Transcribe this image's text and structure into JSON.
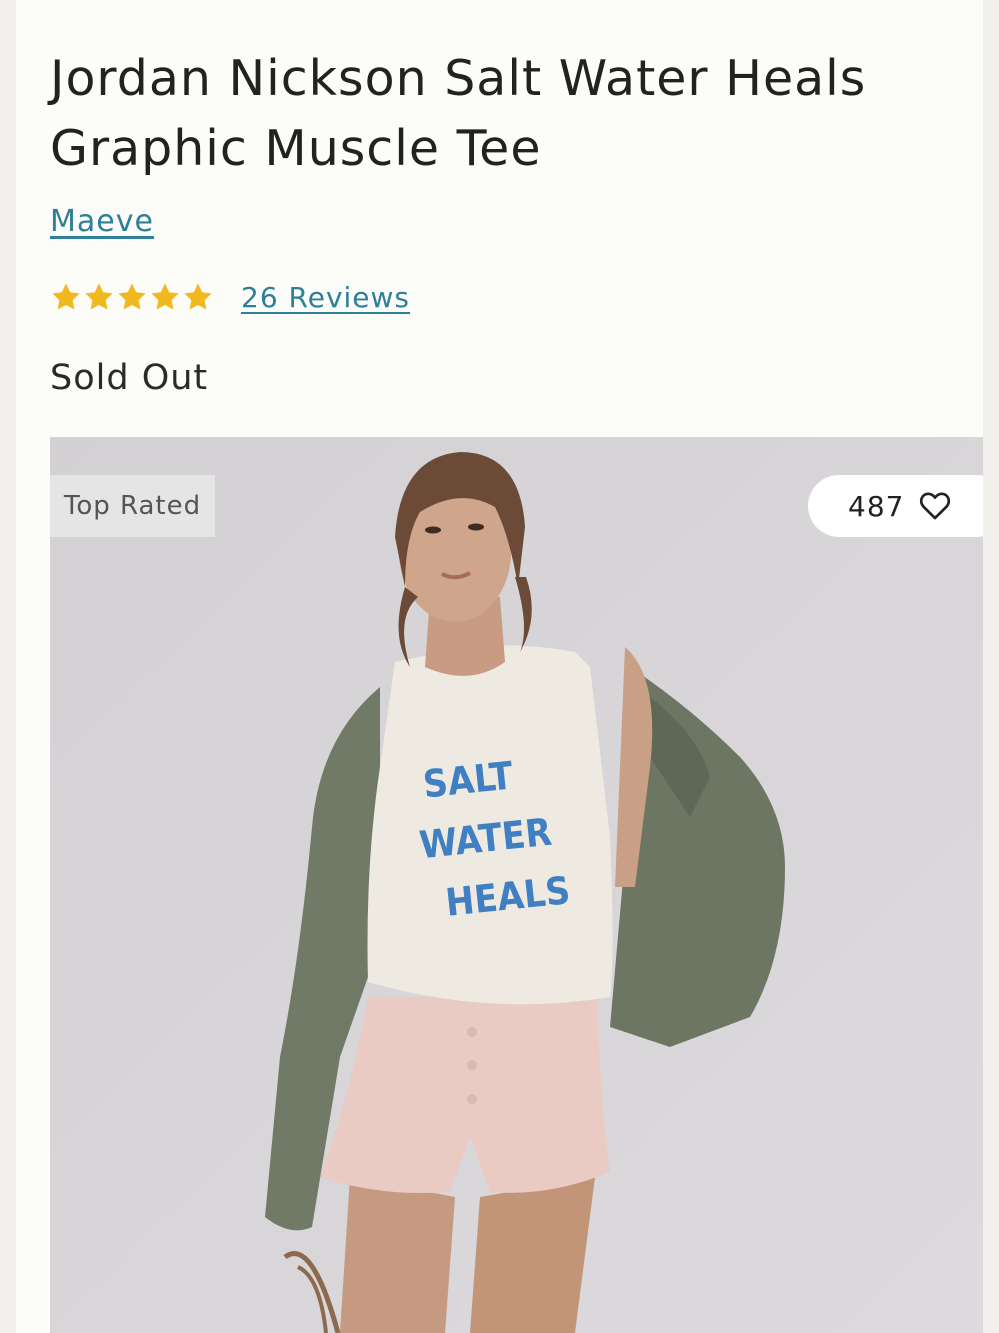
{
  "product": {
    "title": "Jordan Nickson Salt Water Heals Graphic Muscle Tee",
    "brand": "Maeve",
    "rating": 5,
    "rating_max": 5,
    "reviews_label": "26 Reviews",
    "status": "Sold Out"
  },
  "image": {
    "badge": "Top Rated",
    "wishlist_count": "487",
    "shirt_text": [
      "SALT",
      "WATER",
      "HEALS"
    ]
  },
  "colors": {
    "link": "#2e7f99",
    "star": "#f1b81f",
    "text": "#222222",
    "photo_bg": "#d7d5d8",
    "shirt_print": "#3f7fc2"
  },
  "icons": {
    "star": "star-icon",
    "wishlist": "heart-icon"
  }
}
